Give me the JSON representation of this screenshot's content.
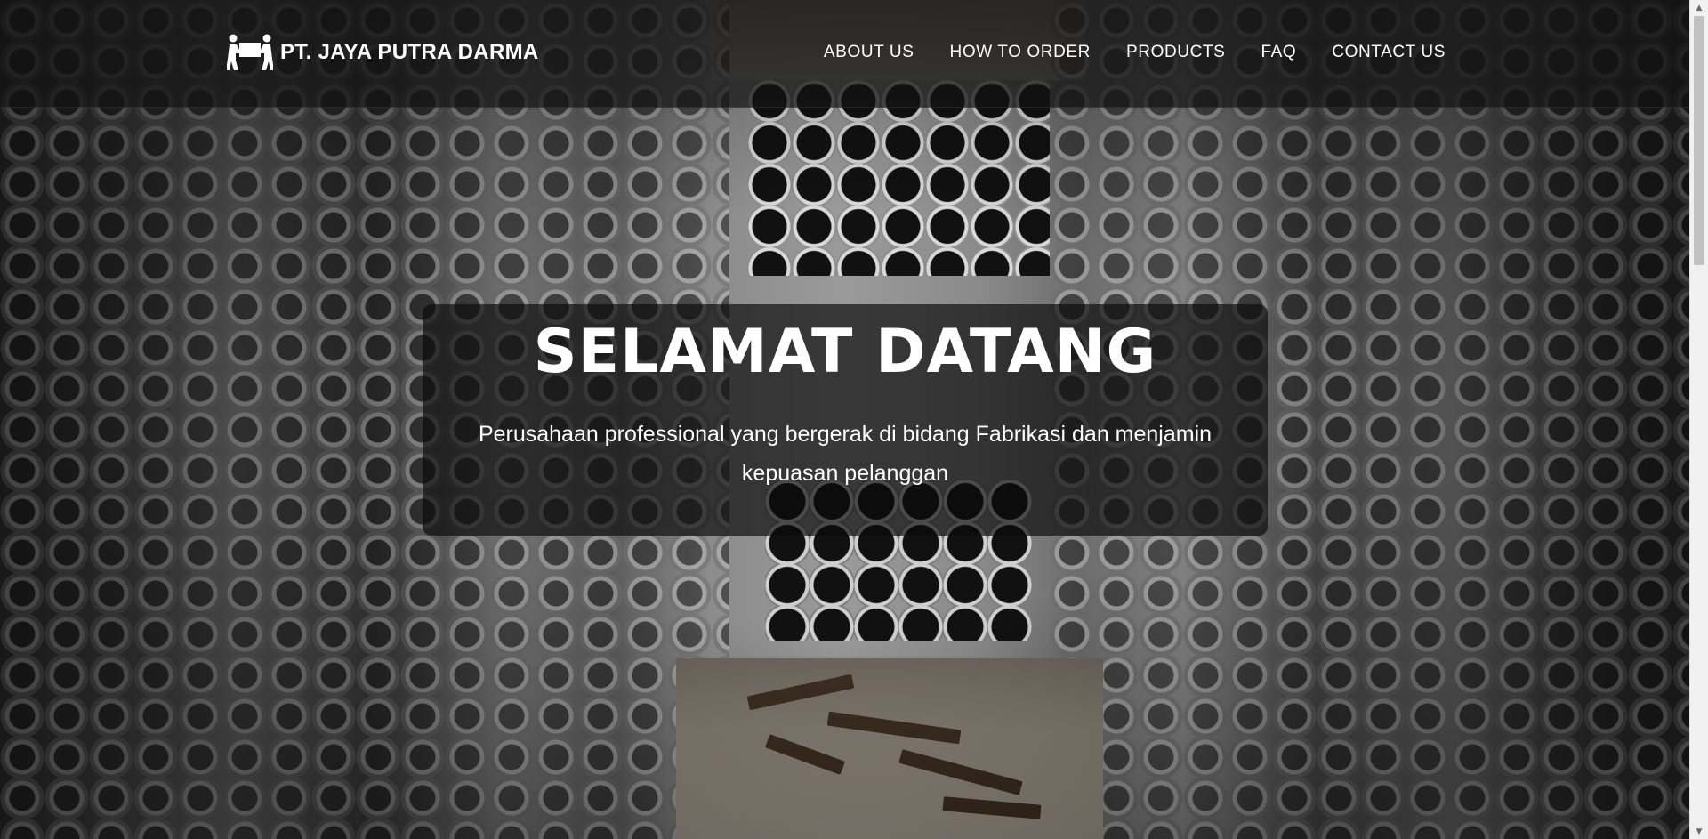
{
  "navbar": {
    "brand_name": "PT. JAYA PUTRA DARMA",
    "brand_icon": "people-carrying-box-icon",
    "links": [
      {
        "label": "ABOUT US"
      },
      {
        "label": "HOW TO ORDER"
      },
      {
        "label": "PRODUCTS"
      },
      {
        "label": "FAQ"
      },
      {
        "label": "CONTACT US"
      }
    ]
  },
  "hero": {
    "title": "SELAMAT DATANG",
    "subtitle": "Perusahaan professional yang bergerak di bidang Fabrikasi dan menjamin kepuasan pelanggan",
    "background_description_icon": "steel-pipes-image"
  },
  "scrollbar": {
    "up_arrow": "▲",
    "down_arrow": "▼"
  },
  "colors": {
    "navbar_bg": "#141414",
    "text": "#ffffff",
    "card_bg": "#0a0a0a"
  }
}
